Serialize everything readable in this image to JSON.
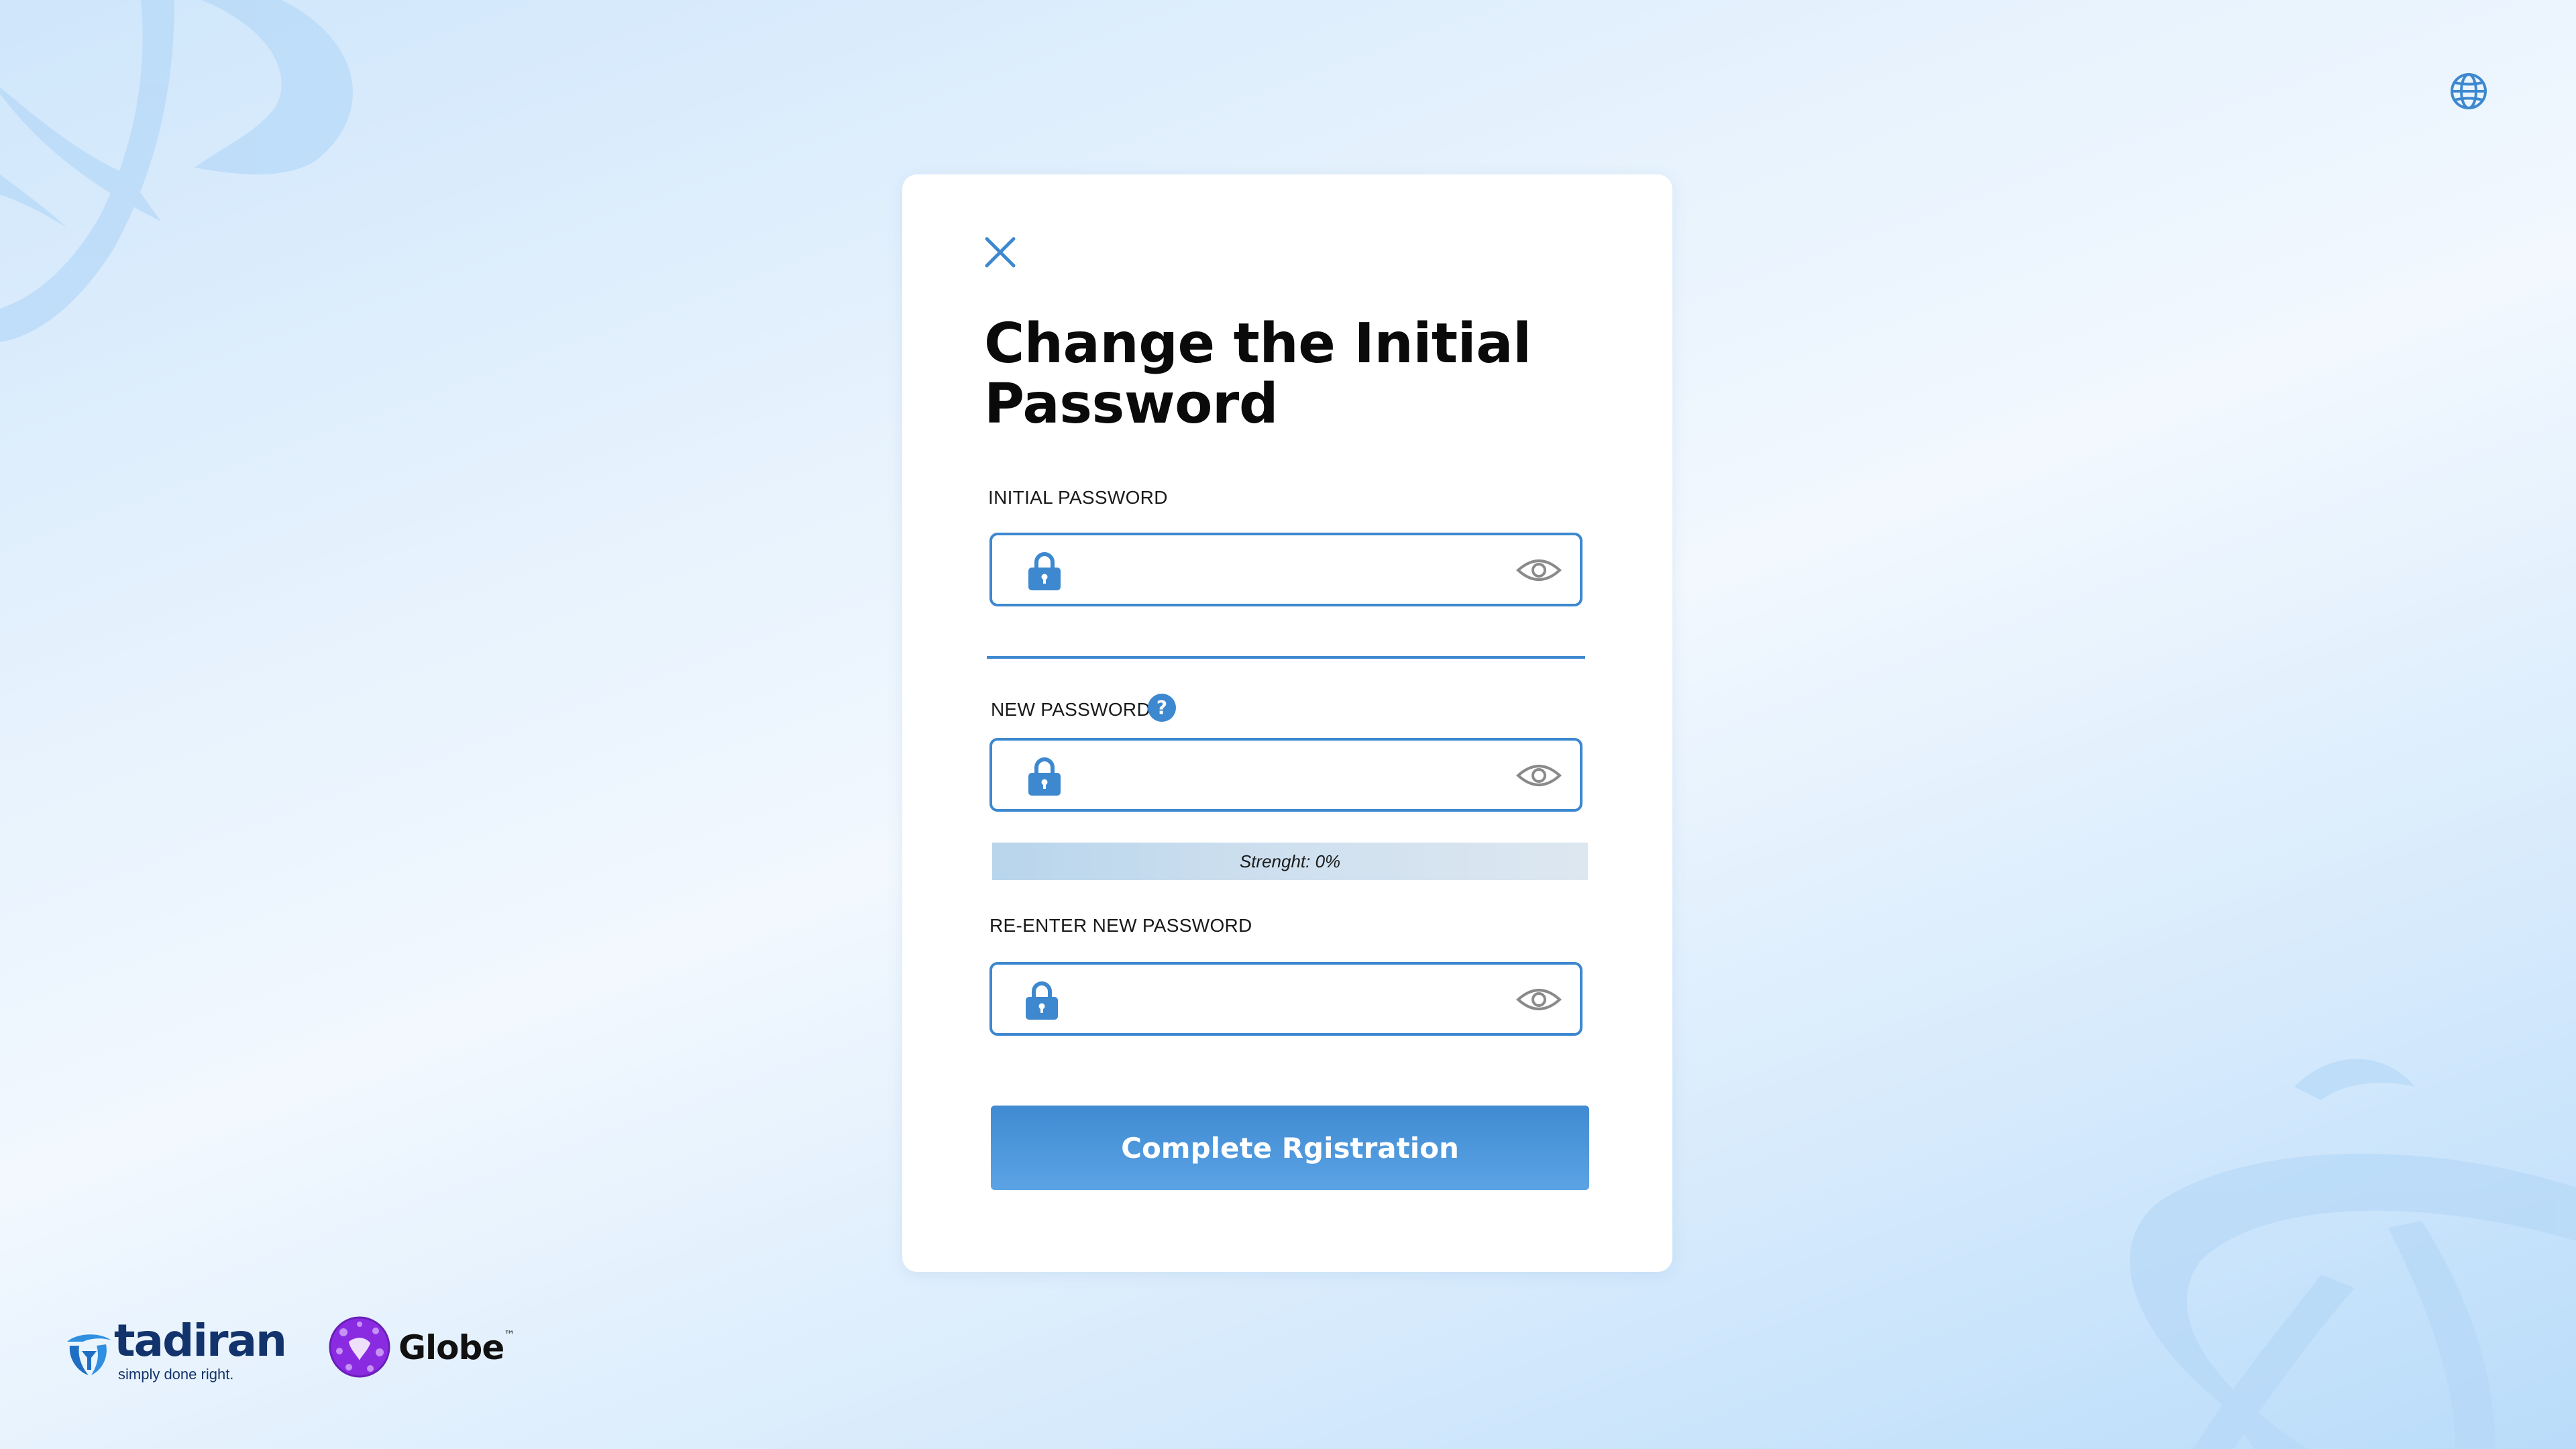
{
  "language_button": {
    "icon": "globe-icon"
  },
  "dialog": {
    "close_icon": "close-icon",
    "title": "Change the Initial Password",
    "initial_password": {
      "label": "INITIAL PASSWORD",
      "value": "",
      "placeholder": "",
      "lock_icon": "lock-icon",
      "toggle_icon": "eye-icon"
    },
    "new_password": {
      "label": "NEW PASSWORD",
      "help_icon": "question-icon",
      "help_glyph": "?",
      "value": "",
      "placeholder": "",
      "lock_icon": "lock-icon",
      "toggle_icon": "eye-icon"
    },
    "strength": {
      "text": "Strenght: 0%",
      "percent": 0
    },
    "confirm_password": {
      "label": "RE-ENTER NEW PASSWORD",
      "value": "",
      "placeholder": "",
      "lock_icon": "lock-icon",
      "toggle_icon": "eye-icon"
    },
    "submit_label": "Complete Rgistration"
  },
  "footer": {
    "tadiran": {
      "name": "tadiran",
      "tagline": "simply done right."
    },
    "globe": {
      "name": "Globe",
      "trademark": "™"
    }
  },
  "colors": {
    "accent": "#3d88cf",
    "button_top": "#3f8ad2",
    "button_bottom": "#5ba3e4",
    "brand_navy": "#12336b",
    "globe_purple": "#8a2be2"
  }
}
